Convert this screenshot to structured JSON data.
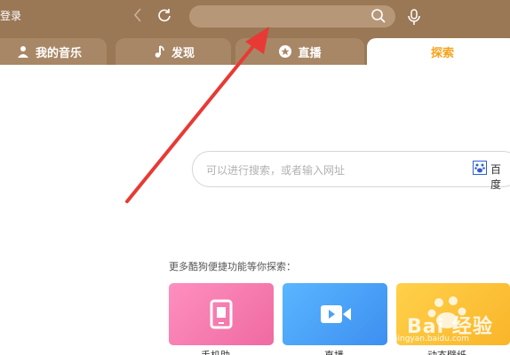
{
  "header": {
    "login_label": "登录",
    "back_icon": "chevron-left-icon",
    "refresh_icon": "refresh-icon",
    "search_icon": "search-icon",
    "mic_icon": "microphone-icon"
  },
  "tabs": [
    {
      "label": "我的音乐",
      "icon": "user-icon"
    },
    {
      "label": "发现",
      "icon": "music-note-icon"
    },
    {
      "label": "直播",
      "icon": "star-icon"
    },
    {
      "label": "探索",
      "icon": ""
    }
  ],
  "main_search": {
    "placeholder": "可以进行搜索，或者输入网址",
    "engine_label": "百度",
    "engine_icon": "baidu-paw-icon"
  },
  "quick": {
    "title": "更多酷狗便捷功能等你探索：",
    "cards": [
      {
        "label": "手机助",
        "icon": "phone-icon"
      },
      {
        "label": "直播",
        "icon": "video-camera-icon"
      },
      {
        "label": "动态壁纸",
        "icon": "wallpaper-icon"
      }
    ]
  },
  "watermark": {
    "text": "Bai 经验",
    "url": "jingyan.baidu.com"
  },
  "colors": {
    "header_bg": "#9a7856",
    "tab_bg": "#a88766",
    "active_tab_text": "#f6a21a",
    "arrow": "#e83a35"
  }
}
